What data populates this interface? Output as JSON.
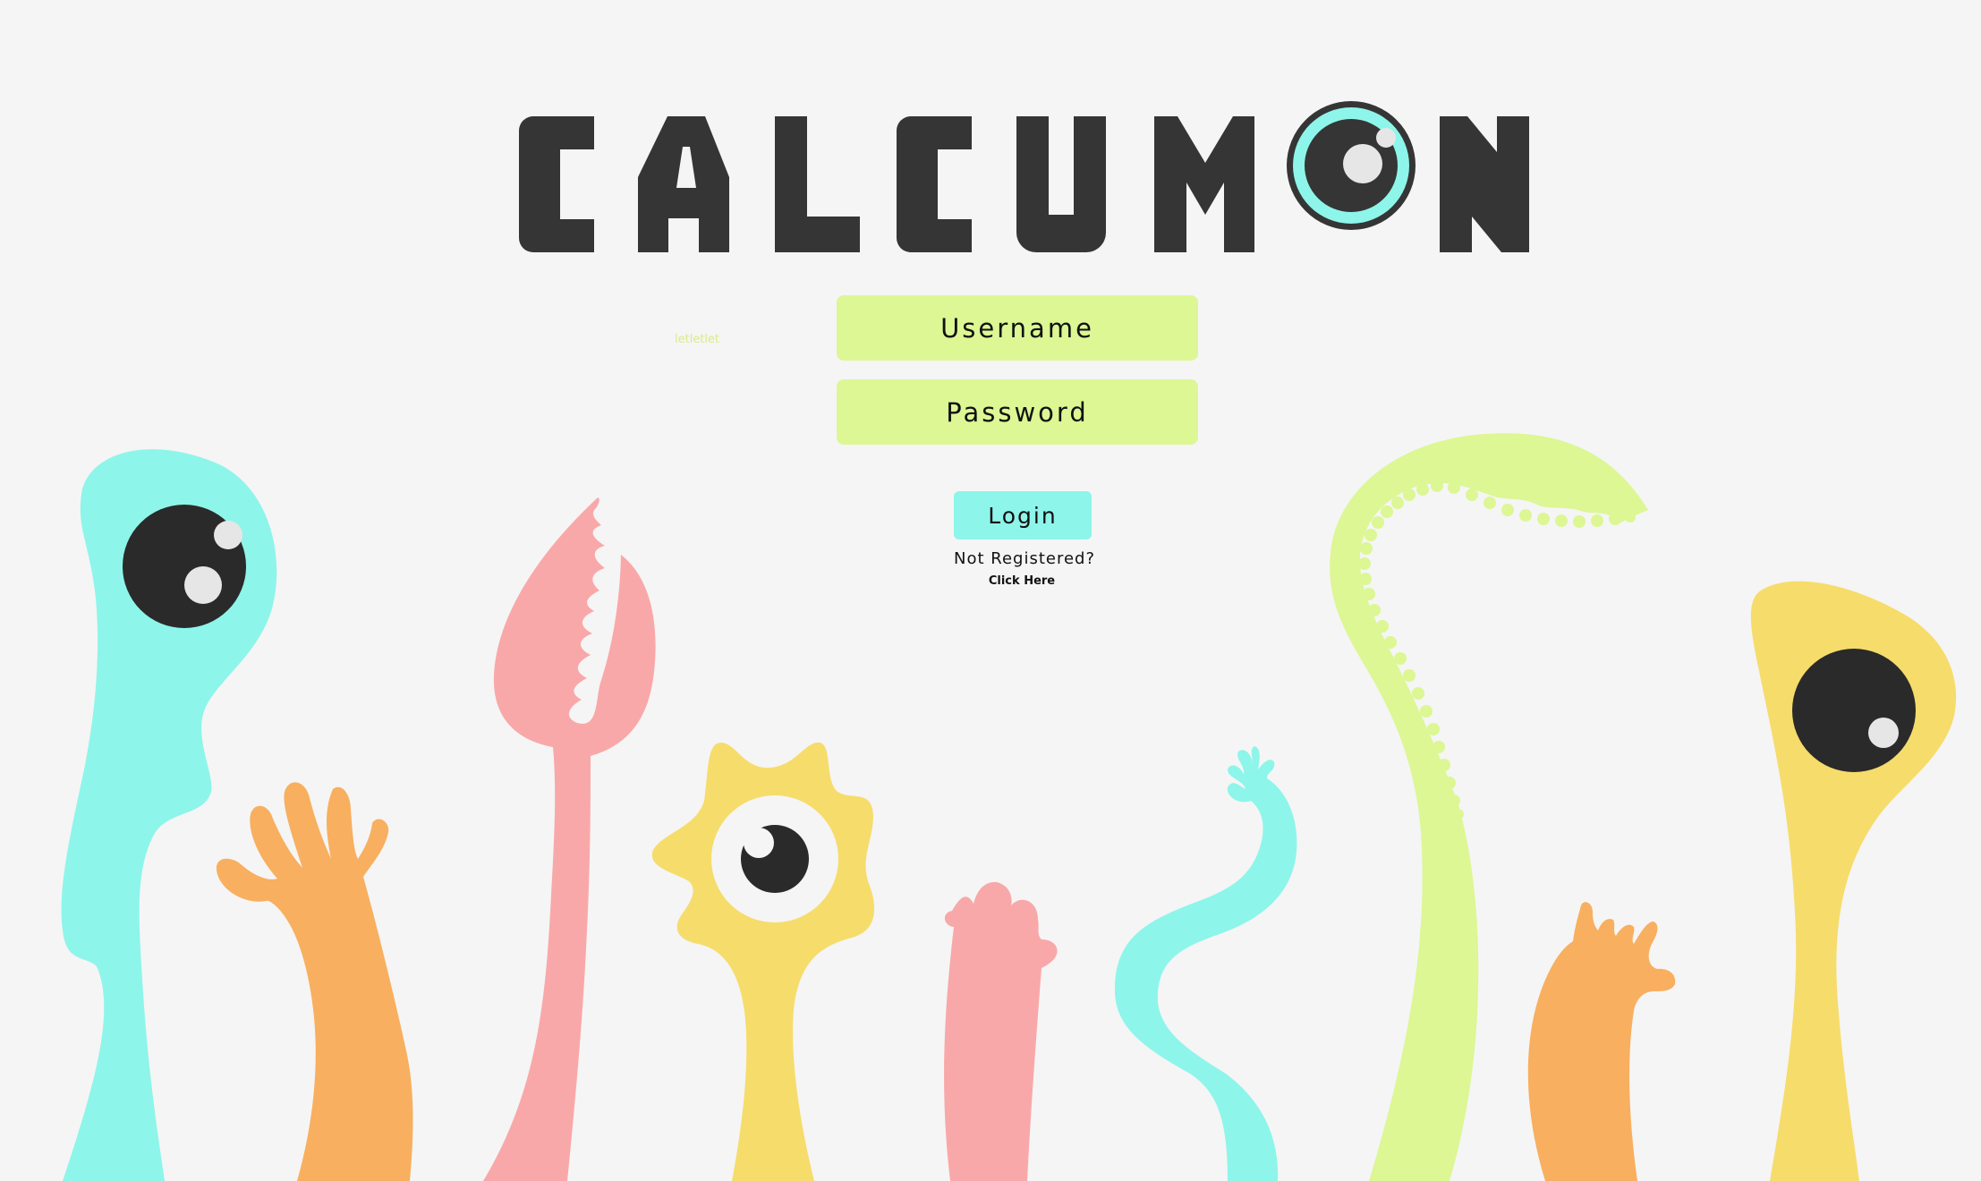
{
  "brand": {
    "name": "CALCUMON",
    "colors": {
      "dark": "#353535",
      "cyan": "#8ef5ea",
      "lime": "#dcf794",
      "pink": "#f9a8a9",
      "orange": "#f8af5f",
      "yellow": "#f6dc6b",
      "background": "#f5f5f5"
    }
  },
  "faint_text": "letletlet",
  "form": {
    "username_placeholder": "Username",
    "password_placeholder": "Password",
    "login_label": "Login",
    "not_registered": "Not Registered?",
    "click_here": "Click Here"
  },
  "illustration": {
    "monsters": [
      "cyan-monster",
      "orange-hand",
      "pink-flytrap",
      "yellow-cyclops",
      "pink-hand",
      "cyan-tentacle",
      "lime-flytrap",
      "orange-hand",
      "yellow-monster"
    ]
  }
}
